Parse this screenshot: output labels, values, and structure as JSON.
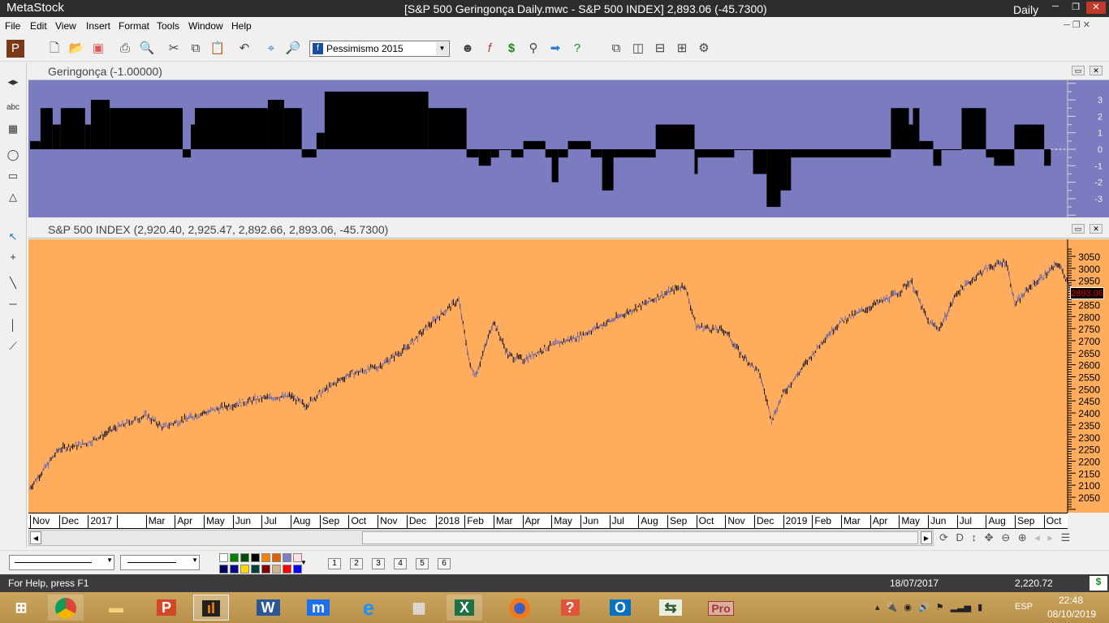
{
  "window": {
    "app": "MetaStock",
    "title": "[S&P 500 Geringonça Daily.mwc - S&P 500 INDEX]   2,893.06 (-45.7300)",
    "periodicity": "Daily"
  },
  "menu": [
    "File",
    "Edit",
    "View",
    "Insert",
    "Format",
    "Tools",
    "Window",
    "Help"
  ],
  "toolbar": {
    "expert_combo": "Pessimismo 2015"
  },
  "indicator_panel": {
    "title": "Geringonça (-1.00000)",
    "y_ticks": [
      "3",
      "2",
      "1",
      "0",
      "-1",
      "-2",
      "-3"
    ]
  },
  "price_panel": {
    "title": "S&P 500 INDEX (2,920.40, 2,925.47, 2,892.66, 2,893.06, -45.7300)",
    "last_price_label": "2893.06"
  },
  "chart_data": [
    {
      "type": "line",
      "title": "S&P 500 INDEX",
      "x_unit": "months since Nov 2016",
      "ylim": [
        2000,
        3100
      ],
      "y_ticks": [
        3050,
        3000,
        2950,
        2900,
        2850,
        2800,
        2750,
        2700,
        2650,
        2600,
        2550,
        2500,
        2450,
        2400,
        2350,
        2300,
        2250,
        2200,
        2150,
        2100,
        2050
      ],
      "x_tick_labels": [
        "Nov",
        "Dec",
        "2017",
        "",
        "Mar",
        "Apr",
        "May",
        "Jun",
        "Jul",
        "Aug",
        "Sep",
        "Oct",
        "Nov",
        "Dec",
        "2018",
        "Feb",
        "Mar",
        "Apr",
        "May",
        "Jun",
        "Jul",
        "Aug",
        "Sep",
        "Oct",
        "Nov",
        "Dec",
        "2019",
        "Feb",
        "Mar",
        "Apr",
        "May",
        "Jun",
        "Jul",
        "Aug",
        "Sep",
        "Oct"
      ],
      "points": [
        [
          0,
          2090
        ],
        [
          0.5,
          2170
        ],
        [
          1,
          2250
        ],
        [
          2,
          2275
        ],
        [
          3,
          2340
        ],
        [
          4,
          2390
        ],
        [
          4.6,
          2340
        ],
        [
          5,
          2360
        ],
        [
          6,
          2400
        ],
        [
          7,
          2435
        ],
        [
          8,
          2460
        ],
        [
          9,
          2470
        ],
        [
          9.5,
          2430
        ],
        [
          10,
          2480
        ],
        [
          11,
          2560
        ],
        [
          12,
          2590
        ],
        [
          13,
          2670
        ],
        [
          14,
          2790
        ],
        [
          14.8,
          2870
        ],
        [
          15.2,
          2590
        ],
        [
          15.4,
          2560
        ],
        [
          16,
          2780
        ],
        [
          16.5,
          2640
        ],
        [
          17,
          2620
        ],
        [
          18,
          2680
        ],
        [
          19,
          2720
        ],
        [
          20,
          2780
        ],
        [
          21,
          2840
        ],
        [
          22,
          2900
        ],
        [
          22.6,
          2930
        ],
        [
          23,
          2760
        ],
        [
          24,
          2740
        ],
        [
          24.5,
          2650
        ],
        [
          25.2,
          2560
        ],
        [
          25.6,
          2370
        ],
        [
          26,
          2480
        ],
        [
          26.5,
          2560
        ],
        [
          27.5,
          2720
        ],
        [
          28,
          2780
        ],
        [
          29,
          2840
        ],
        [
          30,
          2900
        ],
        [
          30.4,
          2950
        ],
        [
          31,
          2780
        ],
        [
          31.4,
          2750
        ],
        [
          32,
          2900
        ],
        [
          33,
          3000
        ],
        [
          33.7,
          3030
        ],
        [
          34,
          2850
        ],
        [
          34.5,
          2920
        ],
        [
          35,
          2970
        ],
        [
          35.5,
          3020
        ],
        [
          35.8,
          2950
        ],
        [
          36,
          2893
        ]
      ]
    },
    {
      "type": "step",
      "title": "Geringonça",
      "ylim": [
        -3.5,
        3.5
      ],
      "steps": [
        [
          0,
          0.5
        ],
        [
          0.36,
          2.5
        ],
        [
          0.78,
          1.5
        ],
        [
          1.06,
          2.5
        ],
        [
          1.9,
          1.5
        ],
        [
          2.1,
          3
        ],
        [
          2.75,
          2.5
        ],
        [
          5.27,
          -0.5
        ],
        [
          5.55,
          1.5
        ],
        [
          5.69,
          2.5
        ],
        [
          8.21,
          3
        ],
        [
          8.77,
          2.5
        ],
        [
          9.38,
          -0.5
        ],
        [
          9.89,
          1
        ],
        [
          10.17,
          3.5
        ],
        [
          13.75,
          2.5
        ],
        [
          15.07,
          -0.5
        ],
        [
          15.49,
          -1
        ],
        [
          15.91,
          -0.5
        ],
        [
          16.19,
          0
        ],
        [
          16.61,
          -0.5
        ],
        [
          17.03,
          0.5
        ],
        [
          17.79,
          -0.5
        ],
        [
          18.01,
          -2
        ],
        [
          18.24,
          -0.5
        ],
        [
          18.57,
          0.5
        ],
        [
          19.36,
          -0.5
        ],
        [
          19.75,
          -2.5
        ],
        [
          20.14,
          -0.5
        ],
        [
          21.6,
          1.5
        ],
        [
          22.94,
          -1.5
        ],
        [
          23.05,
          -0.5
        ],
        [
          24.31,
          0
        ],
        [
          24.96,
          -1.5
        ],
        [
          25.43,
          -3.5
        ],
        [
          25.91,
          -2.5
        ],
        [
          26.27,
          -0.5
        ],
        [
          29.72,
          2.5
        ],
        [
          30.34,
          1.5
        ],
        [
          30.48,
          2.5
        ],
        [
          30.7,
          0.5
        ],
        [
          31.18,
          -1
        ],
        [
          31.46,
          0
        ],
        [
          32.16,
          2.5
        ],
        [
          33.0,
          -0.5
        ],
        [
          33.28,
          -1
        ],
        [
          33.98,
          1.5
        ],
        [
          35.01,
          -1
        ],
        [
          35.24,
          -1
        ]
      ]
    }
  ],
  "bottom": {
    "layout_buttons": [
      "1",
      "2",
      "3",
      "4",
      "5",
      "6"
    ],
    "nav_letter": "D",
    "colors": [
      "#ffffff",
      "#008000",
      "#005000",
      "#000000",
      "#ff8000",
      "#e06000",
      "#8080c0",
      "#ffe0e0",
      "#000060",
      "#000090",
      "#ffd700",
      "#004040",
      "#800000",
      "#d2b48c",
      "#ff0000",
      "#0000ff"
    ]
  },
  "status": {
    "help": "For Help, press F1",
    "date": "18/07/2017",
    "value": "2,220.72",
    "icon": "$"
  },
  "taskbar": {
    "lang": "ESP",
    "time": "22:48",
    "date": "08/10/2019",
    "icons": [
      "windows",
      "chrome",
      "explorer",
      "powerpoint",
      "metastock",
      "word",
      "maxthon",
      "ie",
      "calculator",
      "excel",
      "firefox",
      "help",
      "outlook",
      "project",
      "pro"
    ]
  }
}
